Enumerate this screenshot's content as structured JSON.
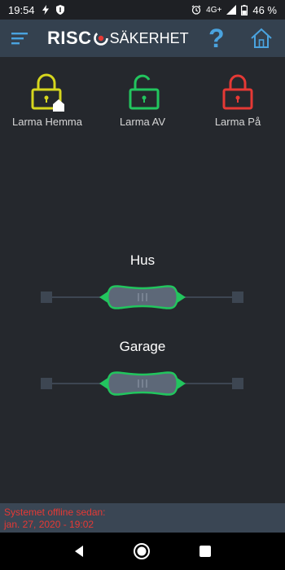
{
  "status_bar": {
    "time": "19:54",
    "network": "4G+",
    "battery": "46 %"
  },
  "header": {
    "brand": "RISC",
    "subtitle": "SÄKERHET",
    "help_label": "?"
  },
  "modes": [
    {
      "label": "Larma Hemma",
      "color": "#d6d61e",
      "icon": "lock-home-icon"
    },
    {
      "label": "Larma AV",
      "color": "#22c55e",
      "icon": "lock-open-icon"
    },
    {
      "label": "Larma På",
      "color": "#e53935",
      "icon": "lock-closed-icon"
    }
  ],
  "partitions": [
    {
      "name": "Hus",
      "state": "Larma AV"
    },
    {
      "name": "Garage",
      "state": "Larma AV"
    }
  ],
  "footer": {
    "line1": "Systemet offline sedan:",
    "line2": "jan. 27, 2020 - 19:02"
  },
  "colors": {
    "background": "#25282d",
    "header": "#34414f",
    "footer": "#3a4654",
    "accent_blue": "#4aa3df",
    "green": "#22c55e",
    "error_red": "#e53935"
  }
}
